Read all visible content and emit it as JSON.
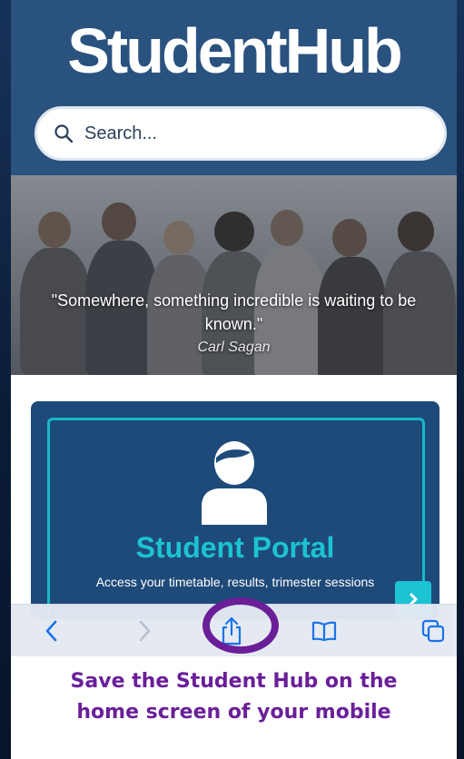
{
  "app": {
    "logo_text": "StudentHub"
  },
  "search": {
    "placeholder": "Search..."
  },
  "hero": {
    "quote": "\"Somewhere, something incredible is waiting to be known.\"",
    "author": "Carl Sagan"
  },
  "card": {
    "title": "Student Portal",
    "description": "Access your timetable, results, trimester sessions"
  },
  "toolbar": {
    "items": [
      "back-icon",
      "forward-icon",
      "share-icon",
      "bookmarks-icon",
      "tabs-icon"
    ]
  },
  "caption": {
    "line1": "Save the Student Hub on the",
    "line2": "home screen of your mobile"
  },
  "colors": {
    "header": "#2a527f",
    "accent": "#1cc3d2",
    "annotation": "#6a1f99",
    "ios_blue": "#1a73e8"
  }
}
